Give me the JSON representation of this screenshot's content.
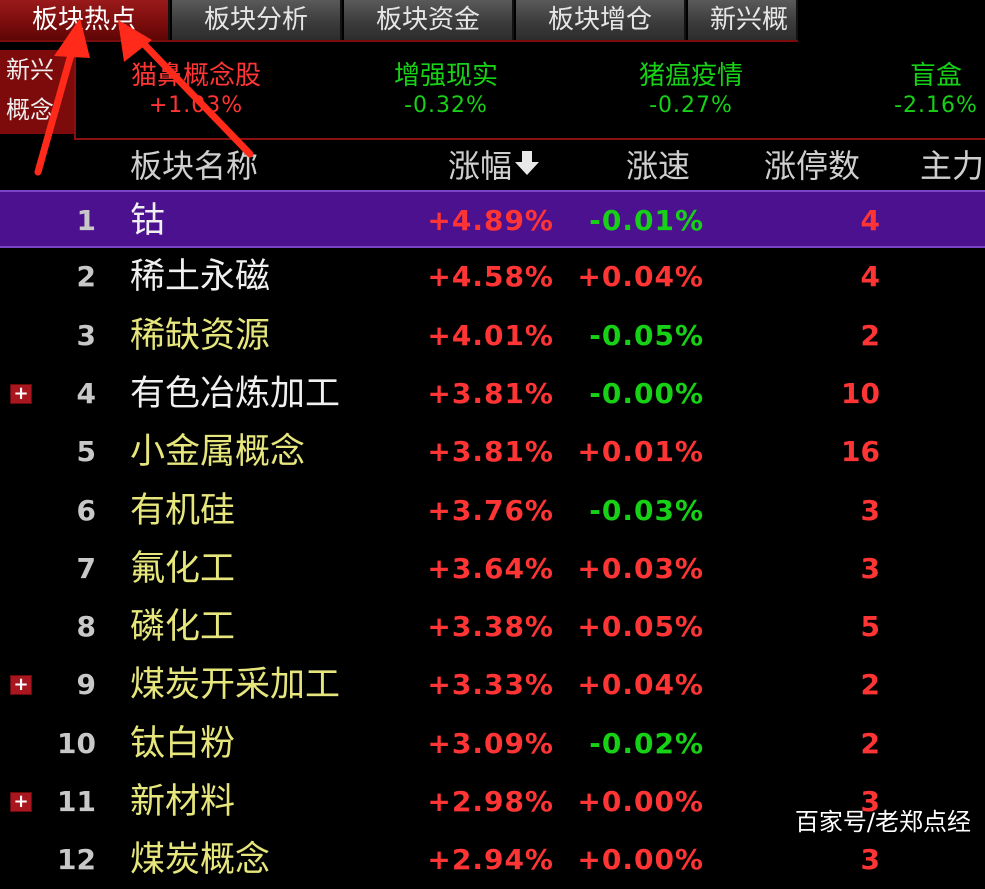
{
  "tabs": [
    {
      "label": "板块热点",
      "active": true
    },
    {
      "label": "板块分析",
      "active": false
    },
    {
      "label": "板块资金",
      "active": false
    },
    {
      "label": "板块增仓",
      "active": false
    },
    {
      "label": "新兴概",
      "active": false
    }
  ],
  "strip": {
    "label_line1": "新兴",
    "label_line2": "概念",
    "items": [
      {
        "name": "猫鼻概念股",
        "pct": "+1.03%",
        "color": "#ff3434",
        "name_color": "#ff3434"
      },
      {
        "name": "增强现实",
        "pct": "-0.32%",
        "color": "#16d116",
        "name_color": "#16d116"
      },
      {
        "name": "猪瘟疫情",
        "pct": "-0.27%",
        "color": "#16d116",
        "name_color": "#16d116"
      },
      {
        "name": "盲盒",
        "pct": "-2.16%",
        "color": "#16d116",
        "name_color": "#16d116"
      }
    ]
  },
  "table": {
    "headers": {
      "name": "板块名称",
      "change": "涨幅",
      "sort_arrow": "🡇",
      "speed": "涨速",
      "limit_up": "涨停数",
      "main": "主力"
    },
    "rows": [
      {
        "idx": "1",
        "name": "钴",
        "name_color": "white",
        "change": "+4.89%",
        "speed": "-0.01%",
        "speed_dir": "down",
        "limit": "4",
        "expand": false,
        "selected": true
      },
      {
        "idx": "2",
        "name": "稀土永磁",
        "name_color": "white",
        "change": "+4.58%",
        "speed": "+0.04%",
        "speed_dir": "up",
        "limit": "4",
        "expand": false,
        "selected": false
      },
      {
        "idx": "3",
        "name": "稀缺资源",
        "name_color": "yellow",
        "change": "+4.01%",
        "speed": "-0.05%",
        "speed_dir": "down",
        "limit": "2",
        "expand": false,
        "selected": false
      },
      {
        "idx": "4",
        "name": "有色冶炼加工",
        "name_color": "white",
        "change": "+3.81%",
        "speed": "-0.00%",
        "speed_dir": "down",
        "limit": "10",
        "expand": true,
        "selected": false
      },
      {
        "idx": "5",
        "name": "小金属概念",
        "name_color": "yellow",
        "change": "+3.81%",
        "speed": "+0.01%",
        "speed_dir": "up",
        "limit": "16",
        "expand": false,
        "selected": false
      },
      {
        "idx": "6",
        "name": "有机硅",
        "name_color": "yellow",
        "change": "+3.76%",
        "speed": "-0.03%",
        "speed_dir": "down",
        "limit": "3",
        "expand": false,
        "selected": false
      },
      {
        "idx": "7",
        "name": "氟化工",
        "name_color": "yellow",
        "change": "+3.64%",
        "speed": "+0.03%",
        "speed_dir": "up",
        "limit": "3",
        "expand": false,
        "selected": false
      },
      {
        "idx": "8",
        "name": "磷化工",
        "name_color": "yellow",
        "change": "+3.38%",
        "speed": "+0.05%",
        "speed_dir": "up",
        "limit": "5",
        "expand": false,
        "selected": false
      },
      {
        "idx": "9",
        "name": "煤炭开采加工",
        "name_color": "yellow",
        "change": "+3.33%",
        "speed": "+0.04%",
        "speed_dir": "up",
        "limit": "2",
        "expand": true,
        "selected": false
      },
      {
        "idx": "10",
        "name": "钛白粉",
        "name_color": "yellow",
        "change": "+3.09%",
        "speed": "-0.02%",
        "speed_dir": "down",
        "limit": "2",
        "expand": false,
        "selected": false
      },
      {
        "idx": "11",
        "name": "新材料",
        "name_color": "yellow",
        "change": "+2.98%",
        "speed": "+0.00%",
        "speed_dir": "up",
        "limit": "3",
        "expand": true,
        "selected": false
      },
      {
        "idx": "12",
        "name": "煤炭概念",
        "name_color": "yellow",
        "change": "+2.94%",
        "speed": "+0.00%",
        "speed_dir": "up",
        "limit": "3",
        "expand": false,
        "selected": false
      }
    ]
  },
  "watermark": "百家号/老郑点经",
  "annotation": {
    "color": "#ff2a1a",
    "icon": "red-arrow-icon"
  }
}
